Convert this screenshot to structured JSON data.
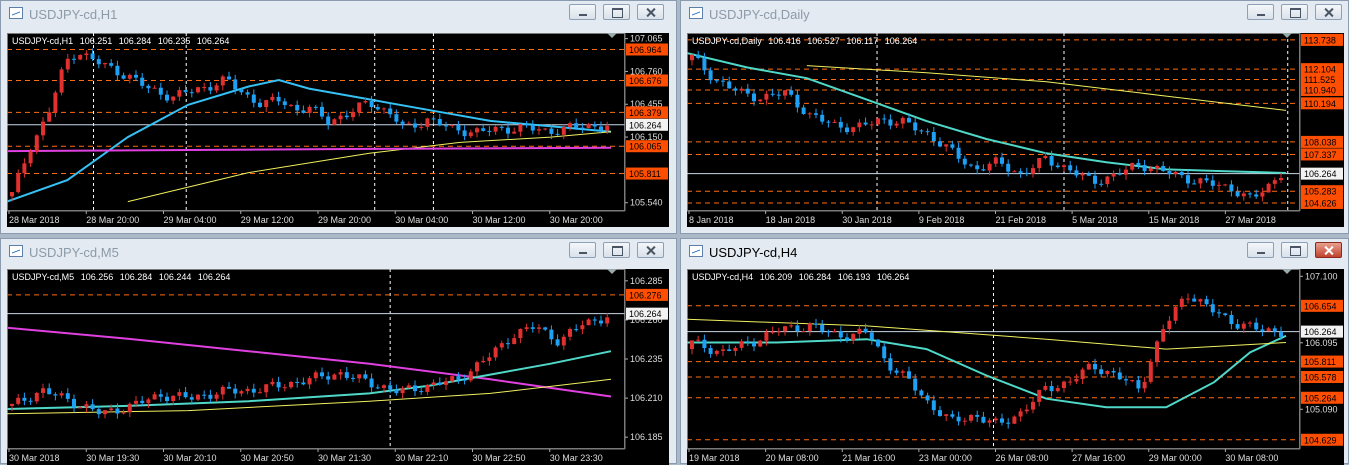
{
  "colors": {
    "bull": "#e8e8e8",
    "bear": "#1ea0f5",
    "bull_body": "#e03030",
    "bear_body": "#1ea0f5",
    "grid": "#ffffff",
    "level": "#ff6a10",
    "level_box": "#ff4e00",
    "ma_fast": "#36c1f4",
    "ma_teal": "#4fd8c8",
    "ma_slow": "#f0f060",
    "ma_magenta": "#e040e0",
    "current": "#c8d8e8"
  },
  "windows": [
    {
      "id": "h1",
      "title": "USDJPY-cd,H1",
      "active": false,
      "info": {
        "symbol": "USDJPY-cd,H1",
        "open": "106.251",
        "high": "106.284",
        "low": "106.235",
        "close": "106.264"
      },
      "pmin": 105.5,
      "pmax": 107.08,
      "current": "106.264",
      "levels": [
        "106.964",
        "106.676",
        "106.379",
        "106.264",
        "106.065",
        "105.811"
      ],
      "ticks": [
        "107.065",
        "106.760",
        "106.455",
        "106.150",
        "105.540"
      ],
      "xlabels": [
        "28 Mar 2018",
        "28 Mar 20:00",
        "29 Mar 04:00",
        "29 Mar 12:00",
        "29 Mar 20:00",
        "30 Mar 04:00",
        "30 Mar 12:00",
        "30 Mar 20:00"
      ],
      "vlines": [
        0.14,
        0.29,
        0.595,
        0.69
      ],
      "series": {
        "start": 105.6,
        "points": [
          [
            0,
            105.62
          ],
          [
            0.03,
            106.05
          ],
          [
            0.06,
            106.35
          ],
          [
            0.09,
            106.85
          ],
          [
            0.11,
            106.95
          ],
          [
            0.13,
            106.88
          ],
          [
            0.17,
            106.78
          ],
          [
            0.2,
            106.7
          ],
          [
            0.23,
            106.6
          ],
          [
            0.27,
            106.52
          ],
          [
            0.3,
            106.58
          ],
          [
            0.33,
            106.62
          ],
          [
            0.36,
            106.68
          ],
          [
            0.39,
            106.55
          ],
          [
            0.42,
            106.45
          ],
          [
            0.45,
            106.5
          ],
          [
            0.48,
            106.4
          ],
          [
            0.5,
            106.42
          ],
          [
            0.53,
            106.3
          ],
          [
            0.56,
            106.35
          ],
          [
            0.6,
            106.48
          ],
          [
            0.64,
            106.35
          ],
          [
            0.66,
            106.22
          ],
          [
            0.7,
            106.32
          ],
          [
            0.74,
            106.22
          ],
          [
            0.78,
            106.2
          ],
          [
            0.82,
            106.22
          ],
          [
            0.86,
            106.24
          ],
          [
            0.9,
            106.2
          ],
          [
            0.94,
            106.24
          ],
          [
            1.0,
            106.26
          ]
        ]
      },
      "mas": [
        {
          "color": "ma_fast",
          "points": [
            [
              0,
              105.55
            ],
            [
              0.1,
              105.75
            ],
            [
              0.2,
              106.15
            ],
            [
              0.3,
              106.45
            ],
            [
              0.4,
              106.62
            ],
            [
              0.45,
              106.68
            ],
            [
              0.5,
              106.6
            ],
            [
              0.6,
              106.5
            ],
            [
              0.7,
              106.4
            ],
            [
              0.8,
              106.3
            ],
            [
              0.9,
              106.25
            ],
            [
              1.0,
              106.2
            ]
          ]
        },
        {
          "color": "ma_slow",
          "points": [
            [
              0.2,
              105.55
            ],
            [
              0.4,
              105.82
            ],
            [
              0.6,
              106.0
            ],
            [
              0.75,
              106.1
            ],
            [
              0.9,
              106.15
            ],
            [
              1.0,
              106.2
            ]
          ]
        },
        {
          "color": "ma_magenta",
          "points": [
            [
              0,
              106.02
            ],
            [
              0.3,
              106.03
            ],
            [
              0.6,
              106.04
            ],
            [
              1.0,
              106.05
            ]
          ]
        }
      ]
    },
    {
      "id": "daily",
      "title": "USDJPY-cd,Daily",
      "active": false,
      "info": {
        "symbol": "USDJPY-cd,Daily",
        "open": "106.416",
        "high": "106.527",
        "low": "106.117",
        "close": "106.264"
      },
      "pmin": 104.4,
      "pmax": 113.9,
      "current": "106.264",
      "levels": [
        "113.738",
        "112.104",
        "111.525",
        "110.940",
        "110.194",
        "108.038",
        "107.337",
        "106.264",
        "105.283",
        "104.626"
      ],
      "ticks": [],
      "xlabels": [
        "8 Jan 2018",
        "18 Jan 2018",
        "30 Jan 2018",
        "9 Feb 2018",
        "21 Feb 2018",
        "5 Mar 2018",
        "15 Mar 2018",
        "27 Mar 2018"
      ],
      "vlines": [
        0.31,
        0.615,
        0.98
      ],
      "series": {
        "start": 112.6,
        "points": [
          [
            0,
            112.8
          ],
          [
            0.04,
            111.5
          ],
          [
            0.08,
            110.8
          ],
          [
            0.12,
            110.5
          ],
          [
            0.16,
            110.8
          ],
          [
            0.2,
            109.5
          ],
          [
            0.24,
            109.0
          ],
          [
            0.28,
            108.8
          ],
          [
            0.32,
            109.3
          ],
          [
            0.36,
            109.1
          ],
          [
            0.4,
            108.5
          ],
          [
            0.44,
            107.5
          ],
          [
            0.48,
            106.5
          ],
          [
            0.52,
            106.9
          ],
          [
            0.56,
            106.2
          ],
          [
            0.6,
            107.1
          ],
          [
            0.64,
            106.5
          ],
          [
            0.68,
            105.8
          ],
          [
            0.72,
            106.2
          ],
          [
            0.76,
            106.8
          ],
          [
            0.8,
            106.4
          ],
          [
            0.84,
            106.0
          ],
          [
            0.88,
            105.7
          ],
          [
            0.92,
            105.4
          ],
          [
            0.95,
            104.8
          ],
          [
            0.98,
            105.6
          ],
          [
            1.0,
            106.3
          ]
        ]
      },
      "mas": [
        {
          "color": "ma_teal",
          "points": [
            [
              0,
              113.0
            ],
            [
              0.1,
              112.2
            ],
            [
              0.2,
              111.6
            ],
            [
              0.3,
              110.4
            ],
            [
              0.4,
              109.2
            ],
            [
              0.5,
              108.2
            ],
            [
              0.6,
              107.4
            ],
            [
              0.7,
              106.9
            ],
            [
              0.8,
              106.5
            ],
            [
              0.9,
              106.4
            ],
            [
              1.0,
              106.3
            ]
          ]
        },
        {
          "color": "ma_slow",
          "points": [
            [
              0.2,
              112.3
            ],
            [
              0.4,
              111.9
            ],
            [
              0.6,
              111.4
            ],
            [
              0.8,
              110.6
            ],
            [
              1.0,
              109.8
            ]
          ]
        }
      ]
    },
    {
      "id": "m5",
      "title": "USDJPY-cd,M5",
      "active": false,
      "info": {
        "symbol": "USDJPY-cd,M5",
        "open": "106.256",
        "high": "106.284",
        "low": "106.244",
        "close": "106.264"
      },
      "pmin": 106.18,
      "pmax": 106.29,
      "current": "106.264",
      "levels": [
        "106.276",
        "106.264"
      ],
      "ticks": [
        "106.285",
        "106.260",
        "106.235",
        "106.210",
        "106.185"
      ],
      "xlabels": [
        "30 Mar 2018",
        "30 Mar 19:30",
        "30 Mar 20:10",
        "30 Mar 20:50",
        "30 Mar 21:30",
        "30 Mar 22:10",
        "30 Mar 22:50",
        "30 Mar 23:30"
      ],
      "vlines": [
        0.62,
        1.04
      ],
      "series": {
        "start": 106.205,
        "points": [
          [
            0,
            106.205
          ],
          [
            0.05,
            106.215
          ],
          [
            0.1,
            106.208
          ],
          [
            0.15,
            106.2
          ],
          [
            0.2,
            106.205
          ],
          [
            0.25,
            106.212
          ],
          [
            0.3,
            106.21
          ],
          [
            0.35,
            106.214
          ],
          [
            0.4,
            106.215
          ],
          [
            0.45,
            106.218
          ],
          [
            0.5,
            106.222
          ],
          [
            0.55,
            106.226
          ],
          [
            0.6,
            106.22
          ],
          [
            0.65,
            106.214
          ],
          [
            0.7,
            106.218
          ],
          [
            0.75,
            106.222
          ],
          [
            0.8,
            106.236
          ],
          [
            0.84,
            106.25
          ],
          [
            0.88,
            106.256
          ],
          [
            0.92,
            106.246
          ],
          [
            0.96,
            106.258
          ],
          [
            1.0,
            106.262
          ]
        ]
      },
      "mas": [
        {
          "color": "ma_magenta",
          "points": [
            [
              0,
              106.255
            ],
            [
              0.2,
              106.248
            ],
            [
              0.4,
              106.24
            ],
            [
              0.6,
              106.232
            ],
            [
              0.8,
              106.222
            ],
            [
              1.0,
              106.211
            ]
          ]
        },
        {
          "color": "ma_teal",
          "points": [
            [
              0,
              106.203
            ],
            [
              0.2,
              106.205
            ],
            [
              0.4,
              106.208
            ],
            [
              0.6,
              106.213
            ],
            [
              0.7,
              106.218
            ],
            [
              0.8,
              106.225
            ],
            [
              0.9,
              106.232
            ],
            [
              1.0,
              106.24
            ]
          ]
        },
        {
          "color": "ma_slow",
          "points": [
            [
              0,
              106.2
            ],
            [
              0.3,
              106.202
            ],
            [
              0.6,
              106.208
            ],
            [
              0.8,
              106.213
            ],
            [
              1.0,
              106.222
            ]
          ]
        }
      ]
    },
    {
      "id": "h4",
      "title": "USDJPY-cd,H4",
      "active": true,
      "info": {
        "symbol": "USDJPY-cd,H4",
        "open": "106.209",
        "high": "106.284",
        "low": "106.193",
        "close": "106.264"
      },
      "pmin": 104.55,
      "pmax": 107.15,
      "current": "106.264",
      "levels": [
        "106.654",
        "106.264",
        "105.811",
        "105.578",
        "105.264",
        "104.629"
      ],
      "ticks": [
        "107.100",
        "106.095",
        "105.090"
      ],
      "xlabels": [
        "19 Mar 2018",
        "20 Mar 08:00",
        "21 Mar 16:00",
        "23 Mar 00:00",
        "26 Mar 08:00",
        "27 Mar 16:00",
        "29 Mar 00:00",
        "30 Mar 08:00"
      ],
      "vlines": [
        0.5,
        1.1
      ],
      "series": {
        "start": 106.0,
        "points": [
          [
            0,
            106.1
          ],
          [
            0.05,
            105.95
          ],
          [
            0.1,
            106.1
          ],
          [
            0.15,
            106.3
          ],
          [
            0.2,
            106.35
          ],
          [
            0.25,
            106.2
          ],
          [
            0.3,
            106.25
          ],
          [
            0.33,
            105.8
          ],
          [
            0.37,
            105.5
          ],
          [
            0.4,
            105.2
          ],
          [
            0.44,
            104.9
          ],
          [
            0.48,
            105.0
          ],
          [
            0.52,
            104.85
          ],
          [
            0.56,
            105.05
          ],
          [
            0.6,
            105.4
          ],
          [
            0.64,
            105.5
          ],
          [
            0.68,
            105.75
          ],
          [
            0.72,
            105.6
          ],
          [
            0.76,
            105.4
          ],
          [
            0.8,
            106.3
          ],
          [
            0.84,
            106.85
          ],
          [
            0.88,
            106.6
          ],
          [
            0.92,
            106.4
          ],
          [
            0.96,
            106.3
          ],
          [
            1.0,
            106.26
          ]
        ]
      },
      "mas": [
        {
          "color": "ma_teal",
          "points": [
            [
              0,
              106.1
            ],
            [
              0.15,
              106.1
            ],
            [
              0.3,
              106.15
            ],
            [
              0.4,
              106.0
            ],
            [
              0.5,
              105.6
            ],
            [
              0.6,
              105.25
            ],
            [
              0.7,
              105.12
            ],
            [
              0.8,
              105.12
            ],
            [
              0.88,
              105.5
            ],
            [
              0.94,
              105.95
            ],
            [
              1.0,
              106.2
            ]
          ]
        },
        {
          "color": "ma_slow",
          "points": [
            [
              0,
              106.45
            ],
            [
              0.3,
              106.35
            ],
            [
              0.6,
              106.15
            ],
            [
              0.8,
              106.0
            ],
            [
              1.0,
              106.1
            ]
          ]
        }
      ]
    }
  ]
}
